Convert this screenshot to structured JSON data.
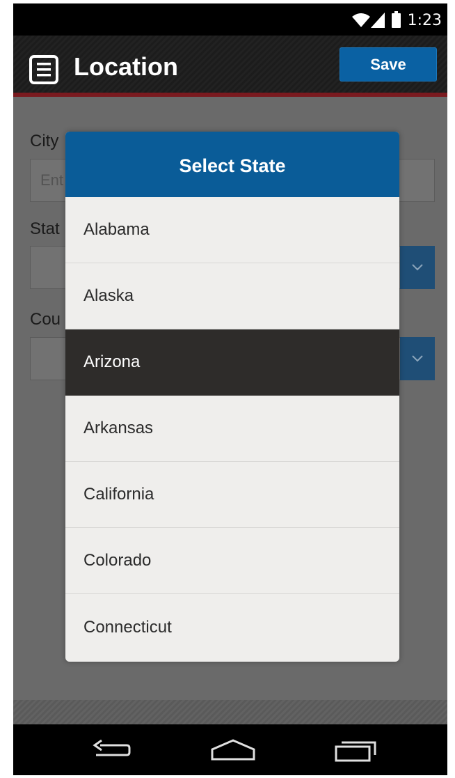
{
  "status_bar": {
    "time": "1:23"
  },
  "action_bar": {
    "title": "Location",
    "save_label": "Save"
  },
  "form": {
    "city_label": "City",
    "city_placeholder": "Ent",
    "state_label": "Stat",
    "country_label": "Cou"
  },
  "dialog": {
    "title": "Select State",
    "options": [
      "Alabama",
      "Alaska",
      "Arizona",
      "Arkansas",
      "California",
      "Colorado",
      "Connecticut"
    ],
    "selected": "Arizona"
  },
  "colors": {
    "header_blue": "#0a5c98",
    "save_blue": "#0a61a3",
    "accent_red": "#7a1a1f",
    "selected_row": "#2e2c2a"
  },
  "icons": [
    "wifi-icon",
    "signal-icon",
    "battery-icon",
    "menu-icon",
    "chevron-down-icon",
    "back-icon",
    "home-icon",
    "recents-icon"
  ]
}
